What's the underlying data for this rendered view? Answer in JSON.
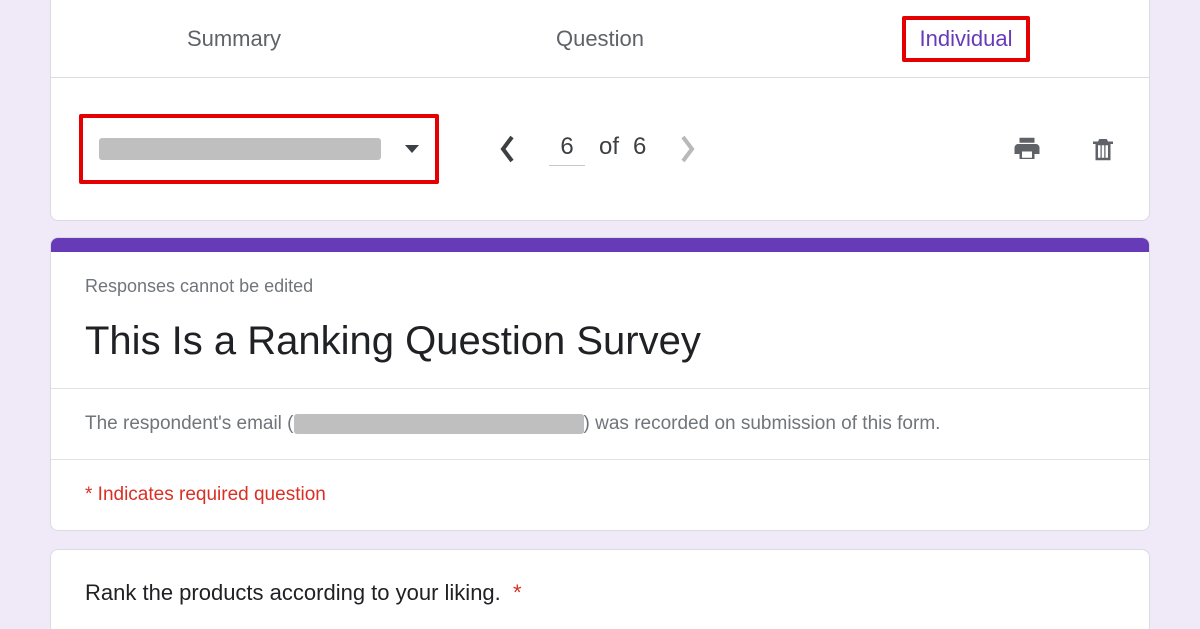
{
  "tabs": {
    "summary": "Summary",
    "question": "Question",
    "individual": "Individual"
  },
  "pager": {
    "current": "6",
    "of": "of",
    "total": "6"
  },
  "form": {
    "no_edit": "Responses cannot be edited",
    "title": "This Is a Ranking Question Survey",
    "email_prefix": "The respondent's email (",
    "email_suffix": ") was recorded on submission of this form.",
    "required_note": "* Indicates required question"
  },
  "question": {
    "text": "Rank the products according to your liking.",
    "asterisk": "*"
  }
}
